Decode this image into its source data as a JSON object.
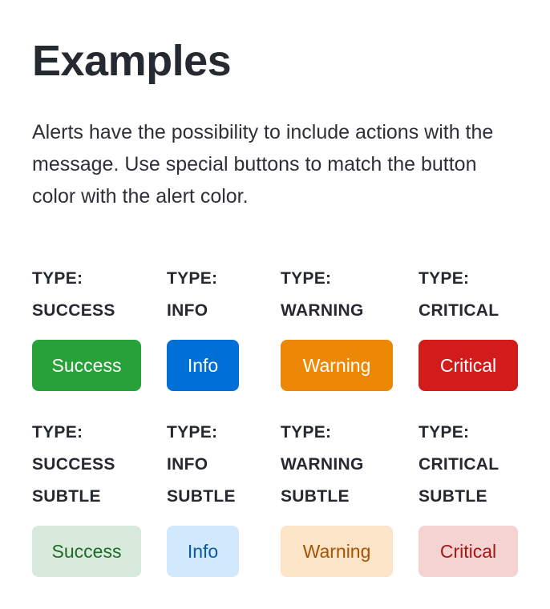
{
  "title": "Examples",
  "description": "Alerts have the possibility to include actions with the message. Use special buttons to match the button color with the alert color.",
  "row1": [
    {
      "type_prefix": "TYPE:",
      "type_name": "SUCCESS",
      "button_label": "Success",
      "color": "#28a138"
    },
    {
      "type_prefix": "TYPE:",
      "type_name": "INFO",
      "button_label": "Info",
      "color": "#0070d6"
    },
    {
      "type_prefix": "TYPE:",
      "type_name": "WARNING",
      "button_label": "Warning",
      "color": "#ec8806"
    },
    {
      "type_prefix": "TYPE:",
      "type_name": "CRITICAL",
      "button_label": "Critical",
      "color": "#d21c1c"
    }
  ],
  "row2": [
    {
      "type_prefix": "TYPE:",
      "type_name": "SUCCESS",
      "type_variant": "SUBTLE",
      "button_label": "Success",
      "color": "#d8eadb",
      "text_color": "#1e6b29"
    },
    {
      "type_prefix": "TYPE:",
      "type_name": "INFO",
      "type_variant": "SUBTLE",
      "button_label": "Info",
      "color": "#d2e8fc",
      "text_color": "#0a5aa8"
    },
    {
      "type_prefix": "TYPE:",
      "type_name": "WARNING",
      "type_variant": "SUBTLE",
      "button_label": "Warning",
      "color": "#fce4c8",
      "text_color": "#a65302"
    },
    {
      "type_prefix": "TYPE:",
      "type_name": "CRITICAL",
      "type_variant": "SUBTLE",
      "button_label": "Critical",
      "color": "#f6d3d3",
      "text_color": "#a91515"
    }
  ]
}
